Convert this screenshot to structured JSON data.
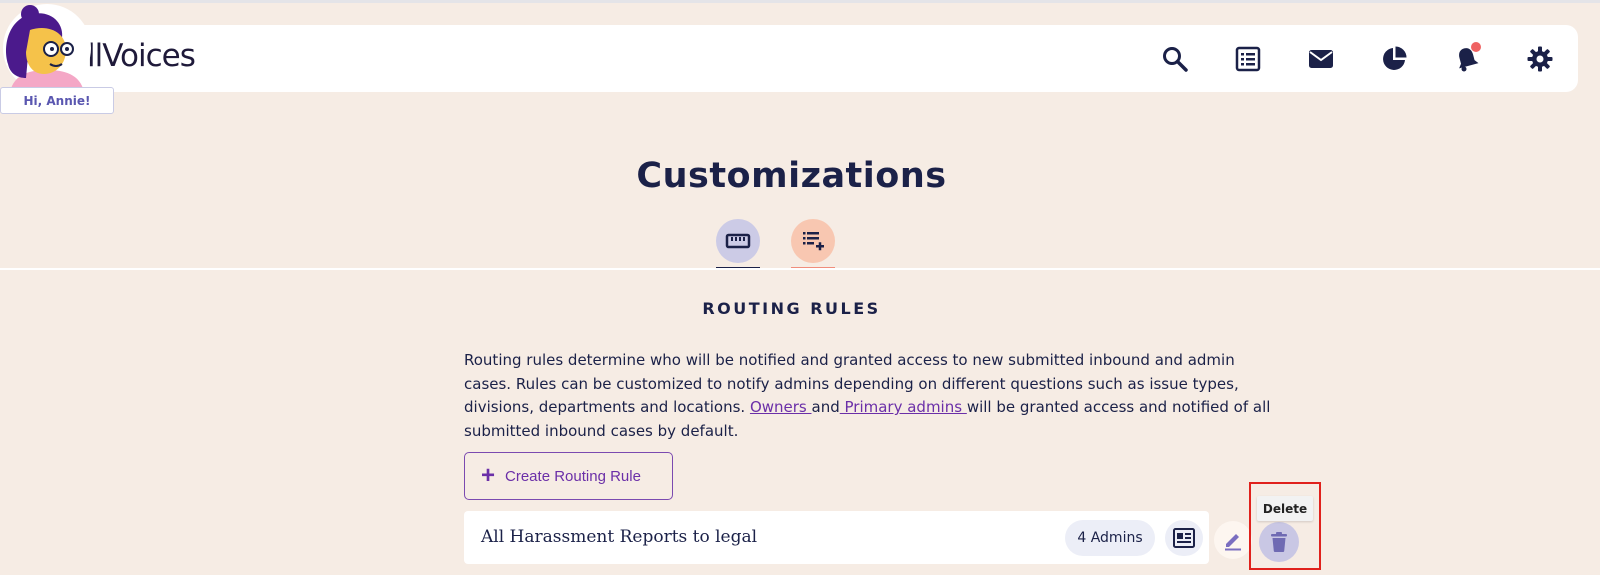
{
  "app": {
    "brand": "llVoices",
    "greeting": "Hi, Annie!"
  },
  "nav": {
    "icons": [
      "search-icon",
      "reports-list-icon",
      "mail-icon",
      "analytics-pie-icon",
      "notifications-bell-icon",
      "settings-gear-icon"
    ],
    "notification_dot_color": "#ef6262"
  },
  "page": {
    "title": "Customizations",
    "tabs": [
      {
        "icon": "ruler-icon",
        "active": true
      },
      {
        "icon": "list-add-icon",
        "active": false
      }
    ]
  },
  "routing": {
    "section_title": "ROUTING RULES",
    "description_1": "Routing rules determine who will be notified and granted access to new submitted inbound and admin cases. Rules can be customized to notify admins depending on different questions such as issue types, divisions, departments and locations. ",
    "link_owners": "Owners ",
    "and": "and",
    "link_primary_admins": " Primary admins ",
    "description_2": "will be granted access and notified of all submitted inbound cases by default.",
    "create_button": "Create Routing Rule",
    "rules": [
      {
        "name": "All Harassment Reports to legal",
        "admins": "4 Admins"
      }
    ],
    "tooltip": "Delete"
  },
  "colors": {
    "background": "#f6ece4",
    "navy": "#1b2148",
    "purple_link": "#6b2fa8",
    "highlight": "#e0211c"
  }
}
